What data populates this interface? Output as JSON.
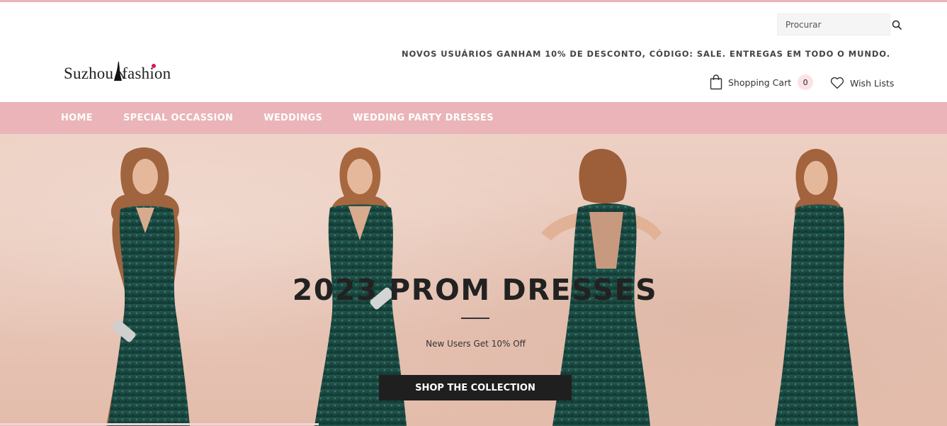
{
  "header": {
    "logo_text_left": "Suzhou",
    "logo_text_right": "fashion",
    "search": {
      "placeholder": "Procurar",
      "value": ""
    },
    "promo": "NOVOS USUÁRIOS GANHAM 10% DE DESCONTO, CÓDIGO: SALE. ENTREGAS EM TODO O MUNDO.",
    "cart": {
      "label": "Shopping Cart",
      "count": "0"
    },
    "wishlist": {
      "label": "Wish Lists"
    }
  },
  "nav": {
    "items": [
      {
        "label": "HOME"
      },
      {
        "label": "SPECIAL OCCASSION"
      },
      {
        "label": "WEDDINGS"
      },
      {
        "label": "WEDDING PARTY DRESSES"
      }
    ]
  },
  "hero": {
    "title": "2023 PROM DRESSES",
    "subtitle": "New Users Get 10% Off",
    "cta": "SHOP THE COLLECTION"
  },
  "colors": {
    "nav_background": "#eab4b8",
    "cta_background": "#1f1f1f",
    "logo_accent": "#e3145a",
    "dress_green": "#1c4f47"
  },
  "icons": {
    "search": "search-icon",
    "cart": "shopping-bag-icon",
    "wishlist": "heart-icon"
  }
}
